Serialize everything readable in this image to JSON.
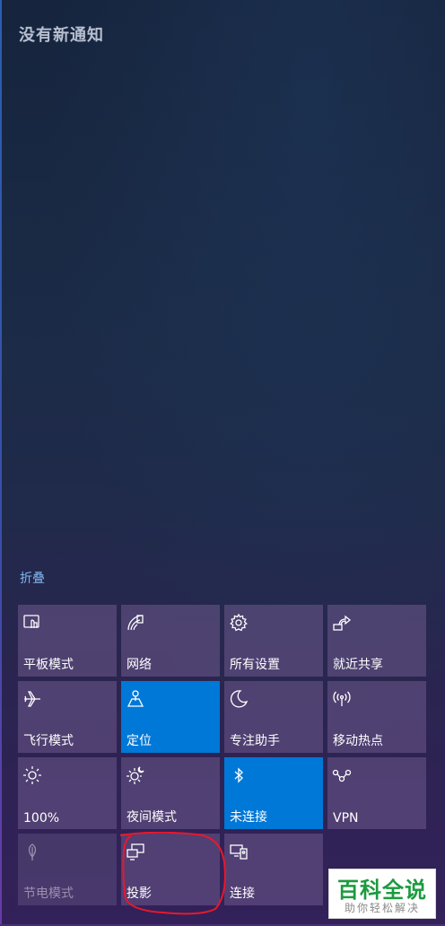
{
  "notification_center": {
    "title": "没有新通知",
    "collapse_label": "折叠"
  },
  "quick_actions": [
    {
      "label": "平板模式",
      "icon": "tablet-mode-icon",
      "state": "off"
    },
    {
      "label": "网络",
      "icon": "network-icon",
      "state": "off"
    },
    {
      "label": "所有设置",
      "icon": "settings-gear-icon",
      "state": "off"
    },
    {
      "label": "就近共享",
      "icon": "nearby-share-icon",
      "state": "off"
    },
    {
      "label": "飞行模式",
      "icon": "airplane-icon",
      "state": "off"
    },
    {
      "label": "定位",
      "icon": "location-icon",
      "state": "on"
    },
    {
      "label": "专注助手",
      "icon": "moon-icon",
      "state": "off"
    },
    {
      "label": "移动热点",
      "icon": "hotspot-icon",
      "state": "off"
    },
    {
      "label": "100%",
      "icon": "brightness-icon",
      "state": "off"
    },
    {
      "label": "夜间模式",
      "icon": "night-light-icon",
      "state": "off"
    },
    {
      "label": "未连接",
      "icon": "bluetooth-icon",
      "state": "on"
    },
    {
      "label": "VPN",
      "icon": "vpn-icon",
      "state": "off"
    },
    {
      "label": "节电模式",
      "icon": "battery-saver-icon",
      "state": "disabled"
    },
    {
      "label": "投影",
      "icon": "project-icon",
      "state": "off"
    },
    {
      "label": "连接",
      "icon": "connect-icon",
      "state": "off"
    }
  ],
  "watermark": {
    "main": "百科全说",
    "sub": "助你轻松解决"
  },
  "colors": {
    "active_tile": "#0078d7",
    "inactive_tile": "#5a4a78",
    "link": "#7fb6f0",
    "annotation": "#e8182c",
    "watermark_green": "#1c9a3f"
  }
}
